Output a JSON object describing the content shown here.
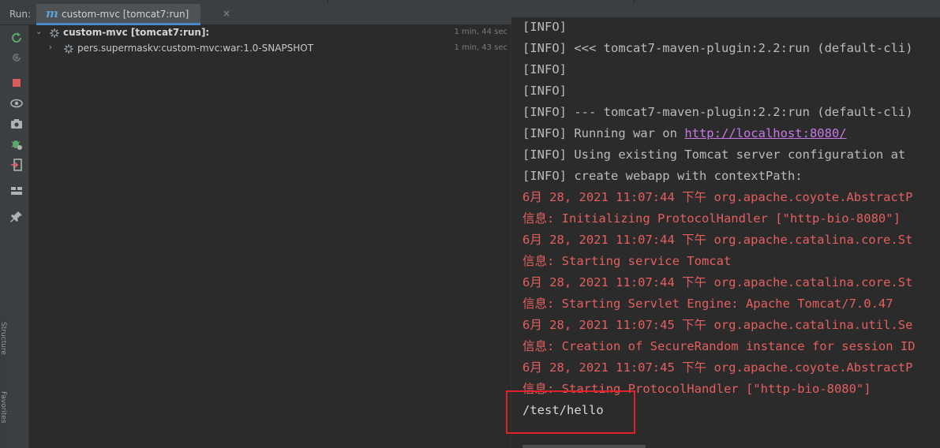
{
  "run_tab": {
    "run_label": "Run:",
    "tab_title": "custom-mvc [tomcat7:run]",
    "close_glyph": "×",
    "icon": "maven-icon",
    "icon_letter": "m"
  },
  "left_toolbar": [
    {
      "name": "rerun-icon"
    },
    {
      "name": "debug-rerun-icon"
    },
    {
      "name": "stop-icon"
    },
    {
      "name": "view-icon"
    },
    {
      "name": "camera-icon"
    },
    {
      "name": "settings-bug-icon"
    },
    {
      "name": "exit-icon"
    },
    {
      "name": "layout-icon"
    },
    {
      "name": "pin-icon"
    }
  ],
  "side_strip": {
    "structure_label": "Structure",
    "favorites_label": "Favorites"
  },
  "tree": {
    "root": {
      "label": "custom-mvc [tomcat7:run]:",
      "time": "1 min, 44 sec"
    },
    "child": {
      "label": "pers.supermaskv:custom-mvc:war:1.0-SNAPSHOT",
      "time": "1 min, 43 sec"
    }
  },
  "console": {
    "lines": [
      {
        "type": "info",
        "text": "[INFO]"
      },
      {
        "type": "info",
        "text": "[INFO] <<< tomcat7-maven-plugin:2.2:run (default-cli)"
      },
      {
        "type": "info",
        "text": "[INFO]"
      },
      {
        "type": "info",
        "text": "[INFO]"
      },
      {
        "type": "info",
        "text": "[INFO] --- tomcat7-maven-plugin:2.2:run (default-cli)"
      },
      {
        "type": "info-link",
        "text": "[INFO] Running war on ",
        "link": "http://localhost:8080/"
      },
      {
        "type": "info",
        "text": "[INFO] Using existing Tomcat server configuration at"
      },
      {
        "type": "info",
        "text": "[INFO] create webapp with contextPath:"
      },
      {
        "type": "err",
        "text": "6月 28, 2021 11:07:44 下午 org.apache.coyote.AbstractP"
      },
      {
        "type": "err",
        "text": "信息: Initializing ProtocolHandler [\"http-bio-8080\"]"
      },
      {
        "type": "err",
        "text": "6月 28, 2021 11:07:44 下午 org.apache.catalina.core.St"
      },
      {
        "type": "err",
        "text": "信息: Starting service Tomcat"
      },
      {
        "type": "err",
        "text": "6月 28, 2021 11:07:44 下午 org.apache.catalina.core.St"
      },
      {
        "type": "err",
        "text": "信息: Starting Servlet Engine: Apache Tomcat/7.0.47"
      },
      {
        "type": "err",
        "text": "6月 28, 2021 11:07:45 下午 org.apache.catalina.util.Se"
      },
      {
        "type": "err",
        "text": "信息: Creation of SecureRandom instance for session ID"
      },
      {
        "type": "err",
        "text": "6月 28, 2021 11:07:45 下午 org.apache.coyote.AbstractP"
      },
      {
        "type": "err",
        "text": "信息: Starting ProtocolHandler [\"http-bio-8080\"]"
      },
      {
        "type": "plain",
        "text": "/test/hello"
      }
    ]
  },
  "colors": {
    "info": "#bbbbbb",
    "error": "#e45f5f",
    "link": "#c978e8",
    "highlight": "#e0202a",
    "tab_accent": "#4a88c7"
  }
}
